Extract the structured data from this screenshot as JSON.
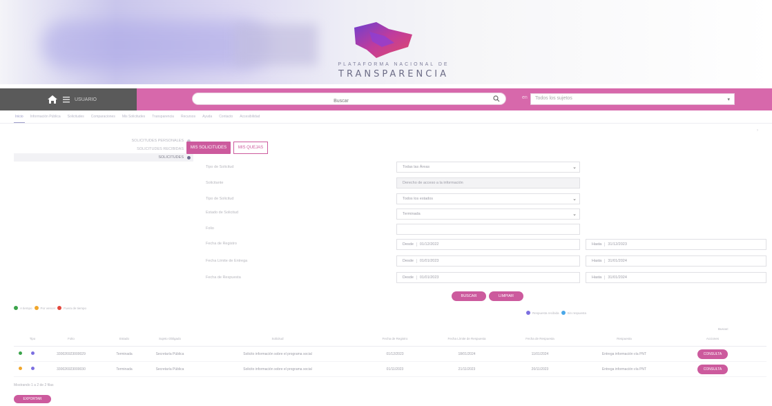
{
  "colors": {
    "brand": "#cc5a9d",
    "navbar": "#d768ab",
    "nav_dark": "#5a5a5a"
  },
  "banner": {
    "line1": "PLATAFORMA NACIONAL DE",
    "line2": "TRANSPARENCIA",
    "logo_icon": "pnt-logo-icon"
  },
  "navbar": {
    "user_label": "USUARIO",
    "search_placeholder": "Buscar",
    "en_label": "en",
    "scope_value": "Todos los sujetos"
  },
  "tabs": [
    "Inicio",
    "Información Pública",
    "Solicitudes",
    "Comparaciones",
    "Mis Solicitudes",
    "Transparencia",
    "Recursos",
    "Ayuda",
    "Contacto",
    "Accesibilidad"
  ],
  "side_menu": [
    {
      "label": "SOLICITUDES PERSONALES",
      "active": false
    },
    {
      "label": "SOLICITUDES RECIBIDAS",
      "active": false
    },
    {
      "label": "SOLICITUDES",
      "active": true
    }
  ],
  "toggles": {
    "mine": "MIS SOLICITUDES",
    "groups": "MIS QUEJAS"
  },
  "form": {
    "fields": [
      {
        "label": "Tipo de Solicitud",
        "value": "Todas las Áreas",
        "type": "select"
      },
      {
        "label": "Solicitante",
        "value": "Derecho de acceso a la información",
        "type": "readonly"
      },
      {
        "label": "Tipo de Solicitud",
        "value": "Todos los estados",
        "type": "select"
      },
      {
        "label": "Estado de Solicitud",
        "value": "Terminada",
        "type": "select"
      },
      {
        "label": "Folio",
        "value": "",
        "type": "text"
      }
    ],
    "date_rows": [
      {
        "label": "Fecha de Registro",
        "from_prefix": "Desde",
        "from": "01/12/2022",
        "to_prefix": "Hasta",
        "to": "31/12/2023"
      },
      {
        "label": "Fecha Límite de Entrega",
        "from_prefix": "Desde",
        "from": "01/01/2023",
        "to_prefix": "Hasta",
        "to": "31/01/2024"
      },
      {
        "label": "Fecha de Respuesta",
        "from_prefix": "Desde",
        "from": "01/01/2023",
        "to_prefix": "Hasta",
        "to": "31/01/2024"
      }
    ],
    "search_btn": "BUSCAR",
    "clear_btn": "LIMPIAR"
  },
  "legend_left": [
    {
      "label": "A tiempo",
      "color": "#3aa34a"
    },
    {
      "label": "Por vencer",
      "color": "#f0a62b"
    },
    {
      "label": "Fuera de tiempo",
      "color": "#e3473c"
    }
  ],
  "legend_right": [
    {
      "label": "Respuesta recibida",
      "color": "#7c6fe0"
    },
    {
      "label": "Sin respuesta",
      "color": "#4aa7e8"
    }
  ],
  "table": {
    "search_label": "Buscar:",
    "headers": [
      "",
      "Tipo",
      "Folio",
      "Estado",
      "Sujeto Obligado",
      "Solicitud",
      "Fecha de Registro",
      "Fecha Límite de Respuesta",
      "Fecha de Respuesta",
      "Respuesta",
      "Acciones"
    ],
    "rows": [
      {
        "dot1": "#3aa34a",
        "dot2": "#7c6fe0",
        "folio": "330026923000029",
        "estado": "Terminada",
        "sujeto": "Secretaría Pública",
        "solicitud": "Solicito información sobre el programa social",
        "registro": "01/12/2023",
        "limite": "18/01/2024",
        "respuesta_fecha": "11/01/2024",
        "respuesta": "Entrega información vía PNT",
        "accion": "CONSULTA"
      },
      {
        "dot1": "#f0a62b",
        "dot2": "#7c6fe0",
        "folio": "330026923000030",
        "estado": "Terminada",
        "sujeto": "Secretaría Pública",
        "solicitud": "Solicito información sobre el programa social",
        "registro": "01/11/2023",
        "limite": "21/11/2023",
        "respuesta_fecha": "20/11/2023",
        "respuesta": "Entrega información vía PNT",
        "accion": "CONSULTA"
      }
    ],
    "records": "Mostrando 1 a 2 de 2 filas",
    "export_btn": "EXPORTAR"
  }
}
